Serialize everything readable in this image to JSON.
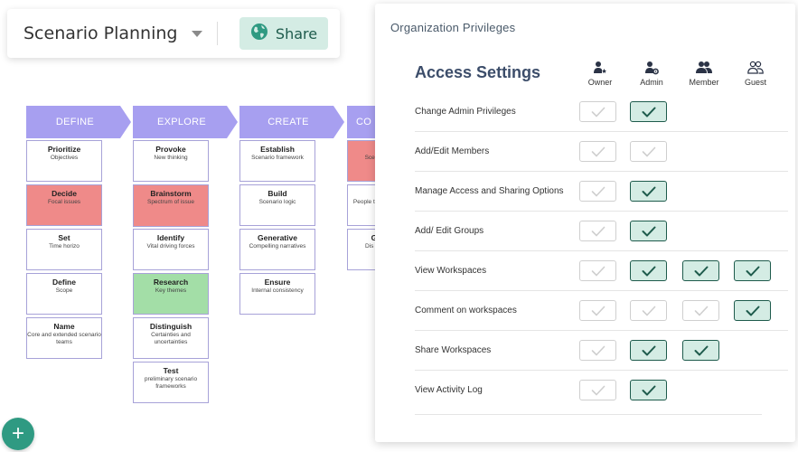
{
  "header": {
    "title": "Scenario Planning",
    "share_label": "Share"
  },
  "board": {
    "columns": [
      {
        "label": "DEFINE",
        "cards": [
          {
            "title": "Prioritize",
            "sub": "Objectives",
            "color": "white"
          },
          {
            "title": "Decide",
            "sub": "Focal issues",
            "color": "red"
          },
          {
            "title": "Set",
            "sub": "Time horizo",
            "color": "white"
          },
          {
            "title": "Define",
            "sub": "Scope",
            "color": "white"
          },
          {
            "title": "Name",
            "sub": "Core and extended scenario teams",
            "color": "white"
          }
        ]
      },
      {
        "label": "EXPLORE",
        "cards": [
          {
            "title": "Provoke",
            "sub": "New thinking",
            "color": "white"
          },
          {
            "title": "Brainstorm",
            "sub": "Spectrum of issue",
            "color": "red"
          },
          {
            "title": "Identify",
            "sub": "Vital driving forces",
            "color": "white"
          },
          {
            "title": "Research",
            "sub": "Key themes",
            "color": "green"
          },
          {
            "title": "Distinguish",
            "sub": "Certainties and uncertainties",
            "color": "white"
          },
          {
            "title": "Test",
            "sub": "preliminary scenario frameworks",
            "color": "white"
          }
        ]
      },
      {
        "label": "CREATE",
        "cards": [
          {
            "title": "Establish",
            "sub": "Scenario framework",
            "color": "white"
          },
          {
            "title": "Build",
            "sub": "Scenario logic",
            "color": "white"
          },
          {
            "title": "Generative",
            "sub": "Compelling narratives",
            "color": "white"
          },
          {
            "title": "Ensure",
            "sub": "Internal consistency",
            "color": "white"
          }
        ]
      },
      {
        "label": "CO",
        "cards": [
          {
            "title": "C",
            "sub": "Scena",
            "color": "red"
          },
          {
            "title": "E",
            "sub": "People the",
            "color": "white"
          },
          {
            "title": "Ge",
            "sub": "Dis im",
            "color": "white"
          }
        ]
      }
    ]
  },
  "panel": {
    "title": "Organization Privileges",
    "access_title": "Access Settings",
    "roles": [
      {
        "label": "Owner",
        "icon": "owner-icon"
      },
      {
        "label": "Admin",
        "icon": "admin-icon"
      },
      {
        "label": "Member",
        "icon": "member-icon"
      },
      {
        "label": "Guest",
        "icon": "guest-icon"
      }
    ],
    "rows": [
      {
        "label": "Change Admin Privileges",
        "checks": [
          "off",
          "on",
          null,
          null
        ]
      },
      {
        "label": "Add/Edit Members",
        "checks": [
          "off",
          "off",
          null,
          null
        ]
      },
      {
        "label": "Manage Access and Sharing Options",
        "checks": [
          "off",
          "on",
          null,
          null
        ]
      },
      {
        "label": "Add/ Edit Groups",
        "checks": [
          "off",
          "on",
          null,
          null
        ]
      },
      {
        "label": "View Workspaces",
        "checks": [
          "off",
          "on",
          "on",
          "on"
        ]
      },
      {
        "label": "Comment on workspaces",
        "checks": [
          "off",
          "off",
          "off",
          "on"
        ]
      },
      {
        "label": "Share Workspaces",
        "checks": [
          "off",
          "on",
          "on",
          null
        ]
      },
      {
        "label": "View Activity Log",
        "checks": [
          "off",
          "on",
          null,
          null
        ]
      }
    ]
  },
  "colors": {
    "chevron": "#a79ff0",
    "card_border": "#a7a2d8",
    "card_red": "#ef8a89",
    "card_green": "#a3dea7",
    "accent": "#1e5b4c",
    "accent_bg": "#d4ece4",
    "fab": "#2f9a82"
  }
}
